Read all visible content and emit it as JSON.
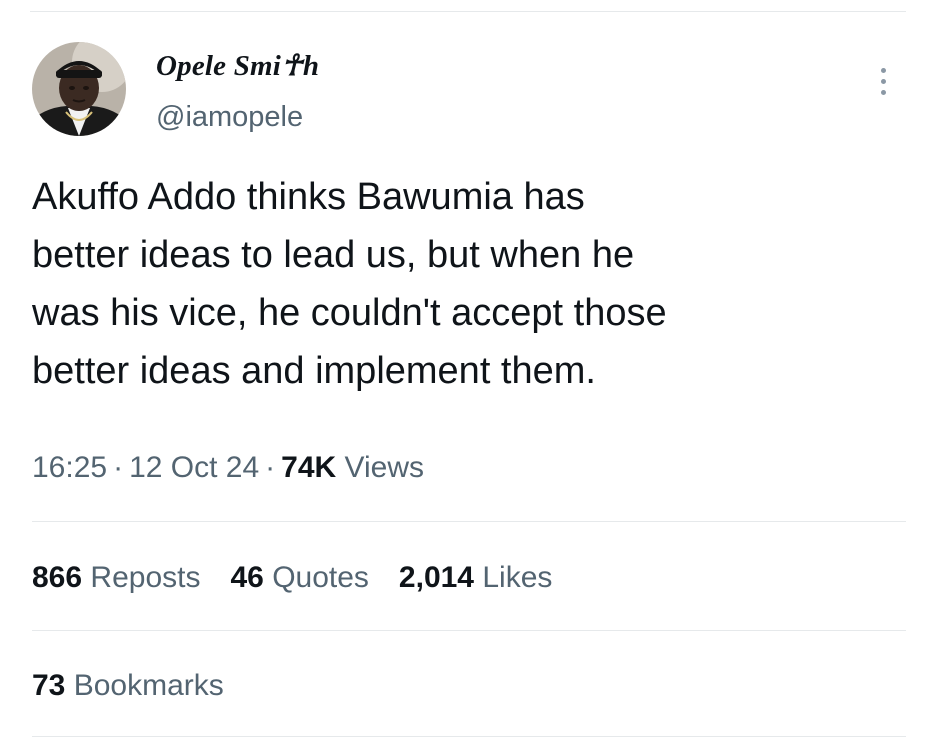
{
  "tweet": {
    "author": {
      "display_name": "Opele Smi☥h",
      "handle": "@iamopele",
      "avatar_icon": "profile-photo"
    },
    "text_lines": [
      "Akuffo Addo thinks Bawumia has",
      "better ideas to lead us, but when he",
      "was his vice, he couldn't accept those",
      "better ideas and implement them."
    ],
    "time": "16:25",
    "date": "12 Oct 24",
    "separator": "·",
    "views_count": "74K",
    "views_label": "Views",
    "stats": {
      "reposts_count": "866",
      "reposts_label": "Reposts",
      "quotes_count": "46",
      "quotes_label": "Quotes",
      "likes_count": "2,014",
      "likes_label": "Likes",
      "bookmarks_count": "73",
      "bookmarks_label": "Bookmarks"
    },
    "more_icon": "more-vertical-icon"
  }
}
